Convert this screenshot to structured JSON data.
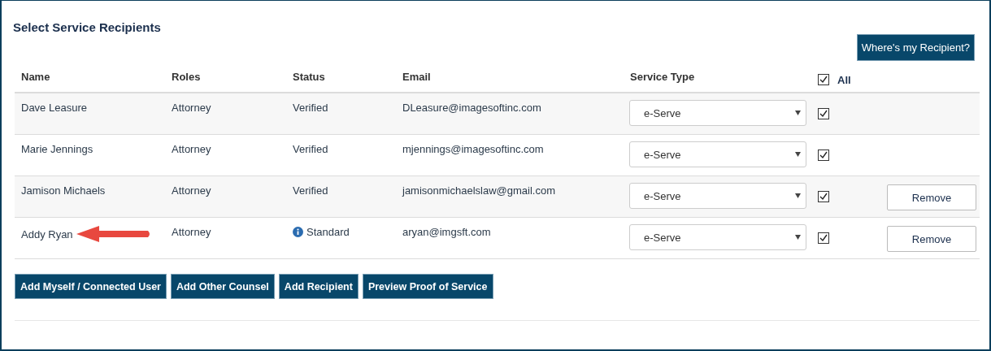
{
  "title": "Select Service Recipients",
  "help_button": "Where's my Recipient?",
  "table": {
    "columns": [
      "Name",
      "Roles",
      "Status",
      "Email",
      "Service Type"
    ],
    "select_all": {
      "label": "All",
      "checked": true
    },
    "rows": [
      {
        "name": "Dave Leasure",
        "role": "Attorney",
        "status": {
          "kind": "plain",
          "text": "Verified"
        },
        "email": "DLeasure@imagesoftinc.com",
        "service_type": "e-Serve",
        "checked": true,
        "arrow": false
      },
      {
        "name": "Marie Jennings",
        "role": "Attorney",
        "status": {
          "kind": "plain",
          "text": "Verified"
        },
        "email": "mjennings@imagesoftinc.com",
        "service_type": "e-Serve",
        "checked": true,
        "arrow": false
      },
      {
        "name": "Jamison Michaels",
        "role": "Attorney",
        "status": {
          "kind": "plain",
          "text": "Verified"
        },
        "email": "jamisonmichaelslaw@gmail.com",
        "service_type": "e-Serve",
        "checked": true,
        "remove": "Remove",
        "arrow": false
      },
      {
        "name": "Addy Ryan",
        "role": "Attorney",
        "status": {
          "kind": "info",
          "text": "Standard"
        },
        "email": "aryan@imgsft.com",
        "service_type": "e-Serve",
        "checked": true,
        "remove": "Remove",
        "arrow": true
      }
    ]
  },
  "actions": [
    "Add Myself / Connected User",
    "Add Other Counsel",
    "Add Recipient",
    "Preview Proof of Service"
  ]
}
